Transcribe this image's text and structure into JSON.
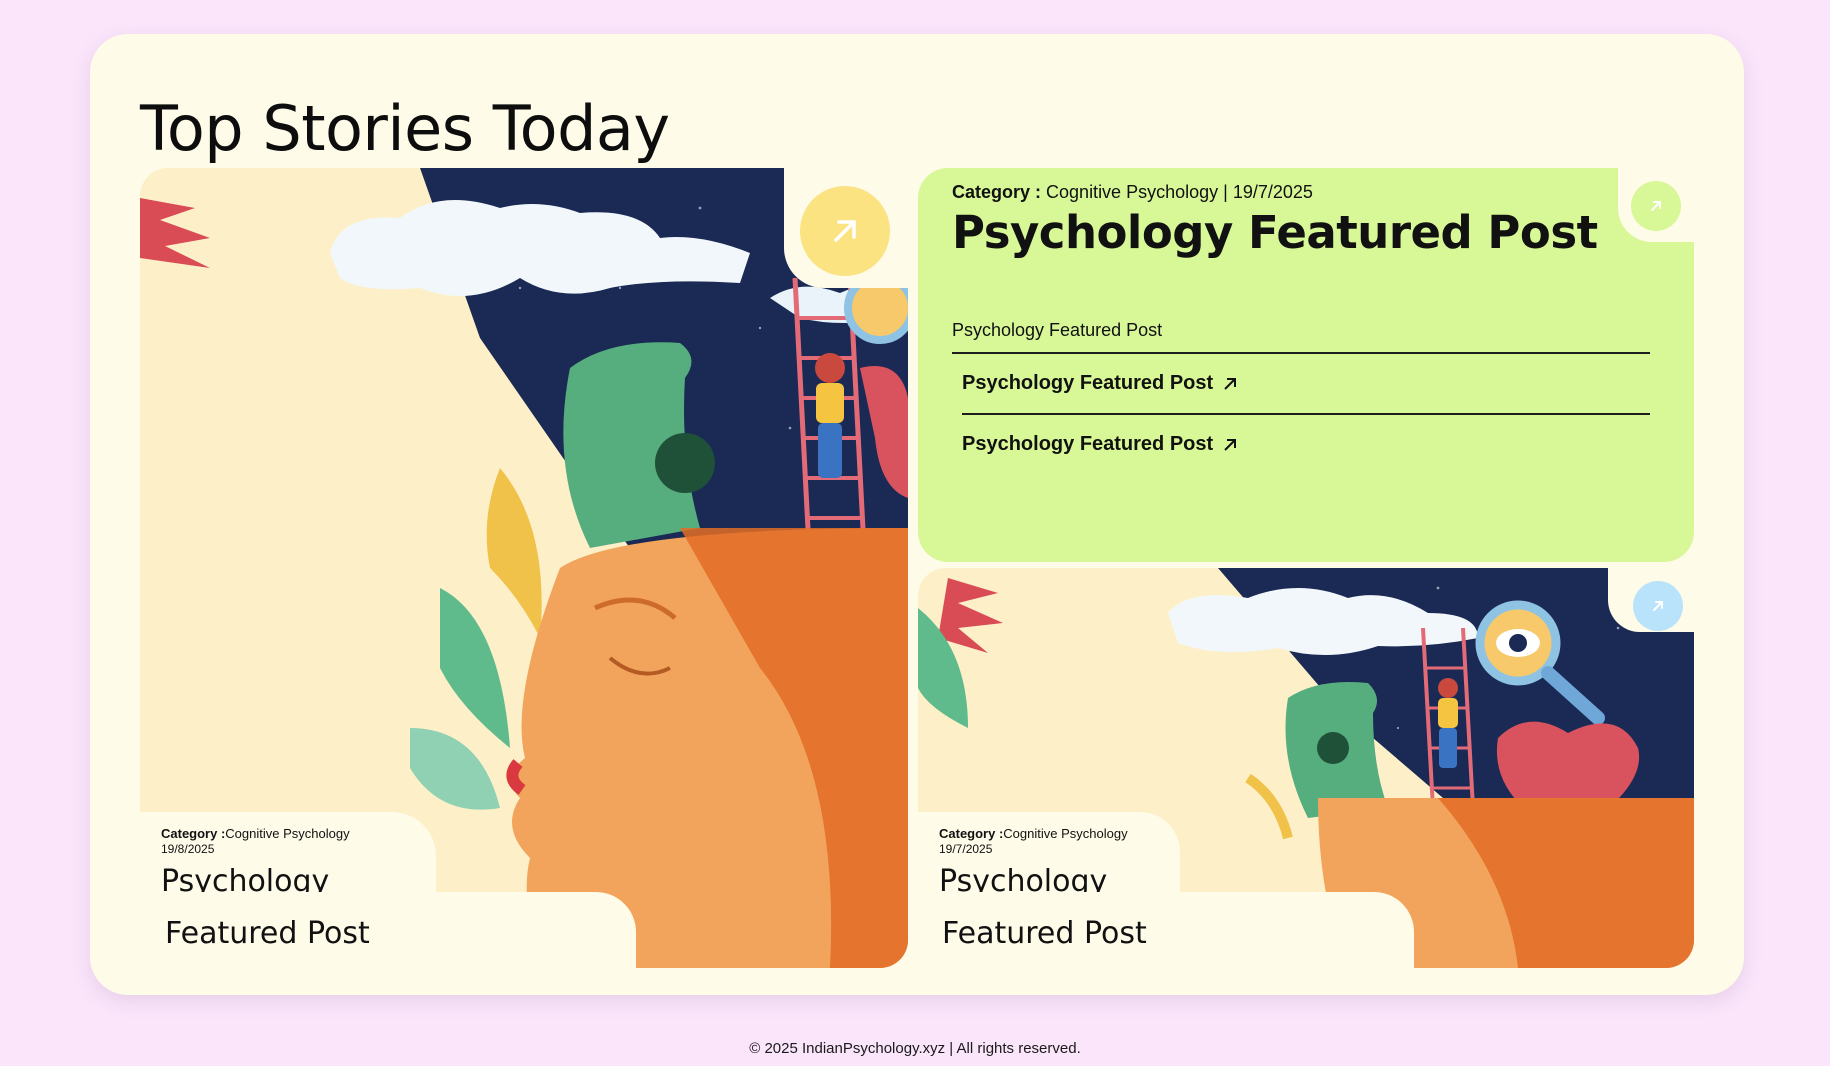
{
  "page": {
    "title": "Top Stories Today",
    "footer": "© 2025 IndianPsychology.xyz | All rights reserved."
  },
  "big_card": {
    "category_label": "Category :",
    "category": "Cognitive Psychology",
    "date": "19/8/2025",
    "title_line1": "Psychology",
    "title_line2": "Featured Post",
    "arrow_color": "#fbe381"
  },
  "featured": {
    "category_label": "Category :",
    "category": "Cognitive Psychology",
    "separator": "|",
    "date": "19/7/2025",
    "title": "Psychology Featured Post",
    "subtitle": "Psychology Featured Post",
    "links": [
      {
        "label": "Psychology Featured Post"
      },
      {
        "label": "Psychology Featured Post"
      }
    ],
    "background": "#d8f898",
    "arrow_color": "#d8f898"
  },
  "small_card": {
    "category_label": "Category :",
    "category": "Cognitive Psychology",
    "date": "19/7/2025",
    "title_line1": "Psychology",
    "title_line2": "Featured Post",
    "arrow_color": "#b9e2fb"
  },
  "icons": {
    "arrow": "arrow-up-right-icon"
  }
}
